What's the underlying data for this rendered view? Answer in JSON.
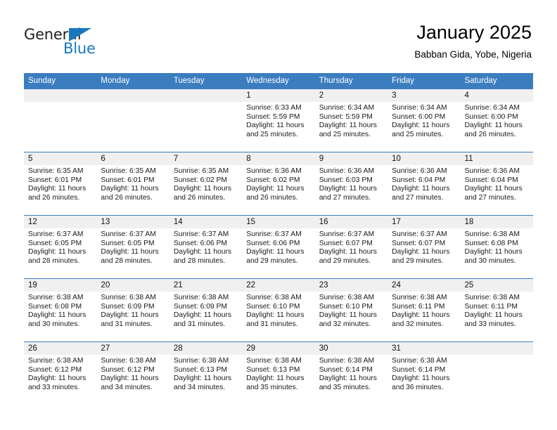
{
  "brand": {
    "name_top": "General",
    "name_bottom": "Blue",
    "accent_color": "#1878be",
    "dark_color": "#231f20"
  },
  "header": {
    "title": "January 2025",
    "subtitle": "Babban Gida, Yobe, Nigeria"
  },
  "calendar": {
    "header_bg": "#3b7dbf",
    "daynum_bg": "#f0f0f0",
    "weekdays": [
      "Sunday",
      "Monday",
      "Tuesday",
      "Wednesday",
      "Thursday",
      "Friday",
      "Saturday"
    ],
    "weeks": [
      [
        {
          "day": "",
          "lines": []
        },
        {
          "day": "",
          "lines": []
        },
        {
          "day": "",
          "lines": []
        },
        {
          "day": "1",
          "lines": [
            "Sunrise: 6:33 AM",
            "Sunset: 5:59 PM",
            "Daylight: 11 hours and 25 minutes."
          ]
        },
        {
          "day": "2",
          "lines": [
            "Sunrise: 6:34 AM",
            "Sunset: 5:59 PM",
            "Daylight: 11 hours and 25 minutes."
          ]
        },
        {
          "day": "3",
          "lines": [
            "Sunrise: 6:34 AM",
            "Sunset: 6:00 PM",
            "Daylight: 11 hours and 25 minutes."
          ]
        },
        {
          "day": "4",
          "lines": [
            "Sunrise: 6:34 AM",
            "Sunset: 6:00 PM",
            "Daylight: 11 hours and 26 minutes."
          ]
        }
      ],
      [
        {
          "day": "5",
          "lines": [
            "Sunrise: 6:35 AM",
            "Sunset: 6:01 PM",
            "Daylight: 11 hours and 26 minutes."
          ]
        },
        {
          "day": "6",
          "lines": [
            "Sunrise: 6:35 AM",
            "Sunset: 6:01 PM",
            "Daylight: 11 hours and 26 minutes."
          ]
        },
        {
          "day": "7",
          "lines": [
            "Sunrise: 6:35 AM",
            "Sunset: 6:02 PM",
            "Daylight: 11 hours and 26 minutes."
          ]
        },
        {
          "day": "8",
          "lines": [
            "Sunrise: 6:36 AM",
            "Sunset: 6:02 PM",
            "Daylight: 11 hours and 26 minutes."
          ]
        },
        {
          "day": "9",
          "lines": [
            "Sunrise: 6:36 AM",
            "Sunset: 6:03 PM",
            "Daylight: 11 hours and 27 minutes."
          ]
        },
        {
          "day": "10",
          "lines": [
            "Sunrise: 6:36 AM",
            "Sunset: 6:04 PM",
            "Daylight: 11 hours and 27 minutes."
          ]
        },
        {
          "day": "11",
          "lines": [
            "Sunrise: 6:36 AM",
            "Sunset: 6:04 PM",
            "Daylight: 11 hours and 27 minutes."
          ]
        }
      ],
      [
        {
          "day": "12",
          "lines": [
            "Sunrise: 6:37 AM",
            "Sunset: 6:05 PM",
            "Daylight: 11 hours and 28 minutes."
          ]
        },
        {
          "day": "13",
          "lines": [
            "Sunrise: 6:37 AM",
            "Sunset: 6:05 PM",
            "Daylight: 11 hours and 28 minutes."
          ]
        },
        {
          "day": "14",
          "lines": [
            "Sunrise: 6:37 AM",
            "Sunset: 6:06 PM",
            "Daylight: 11 hours and 28 minutes."
          ]
        },
        {
          "day": "15",
          "lines": [
            "Sunrise: 6:37 AM",
            "Sunset: 6:06 PM",
            "Daylight: 11 hours and 29 minutes."
          ]
        },
        {
          "day": "16",
          "lines": [
            "Sunrise: 6:37 AM",
            "Sunset: 6:07 PM",
            "Daylight: 11 hours and 29 minutes."
          ]
        },
        {
          "day": "17",
          "lines": [
            "Sunrise: 6:37 AM",
            "Sunset: 6:07 PM",
            "Daylight: 11 hours and 29 minutes."
          ]
        },
        {
          "day": "18",
          "lines": [
            "Sunrise: 6:38 AM",
            "Sunset: 6:08 PM",
            "Daylight: 11 hours and 30 minutes."
          ]
        }
      ],
      [
        {
          "day": "19",
          "lines": [
            "Sunrise: 6:38 AM",
            "Sunset: 6:08 PM",
            "Daylight: 11 hours and 30 minutes."
          ]
        },
        {
          "day": "20",
          "lines": [
            "Sunrise: 6:38 AM",
            "Sunset: 6:09 PM",
            "Daylight: 11 hours and 31 minutes."
          ]
        },
        {
          "day": "21",
          "lines": [
            "Sunrise: 6:38 AM",
            "Sunset: 6:09 PM",
            "Daylight: 11 hours and 31 minutes."
          ]
        },
        {
          "day": "22",
          "lines": [
            "Sunrise: 6:38 AM",
            "Sunset: 6:10 PM",
            "Daylight: 11 hours and 31 minutes."
          ]
        },
        {
          "day": "23",
          "lines": [
            "Sunrise: 6:38 AM",
            "Sunset: 6:10 PM",
            "Daylight: 11 hours and 32 minutes."
          ]
        },
        {
          "day": "24",
          "lines": [
            "Sunrise: 6:38 AM",
            "Sunset: 6:11 PM",
            "Daylight: 11 hours and 32 minutes."
          ]
        },
        {
          "day": "25",
          "lines": [
            "Sunrise: 6:38 AM",
            "Sunset: 6:11 PM",
            "Daylight: 11 hours and 33 minutes."
          ]
        }
      ],
      [
        {
          "day": "26",
          "lines": [
            "Sunrise: 6:38 AM",
            "Sunset: 6:12 PM",
            "Daylight: 11 hours and 33 minutes."
          ]
        },
        {
          "day": "27",
          "lines": [
            "Sunrise: 6:38 AM",
            "Sunset: 6:12 PM",
            "Daylight: 11 hours and 34 minutes."
          ]
        },
        {
          "day": "28",
          "lines": [
            "Sunrise: 6:38 AM",
            "Sunset: 6:13 PM",
            "Daylight: 11 hours and 34 minutes."
          ]
        },
        {
          "day": "29",
          "lines": [
            "Sunrise: 6:38 AM",
            "Sunset: 6:13 PM",
            "Daylight: 11 hours and 35 minutes."
          ]
        },
        {
          "day": "30",
          "lines": [
            "Sunrise: 6:38 AM",
            "Sunset: 6:14 PM",
            "Daylight: 11 hours and 35 minutes."
          ]
        },
        {
          "day": "31",
          "lines": [
            "Sunrise: 6:38 AM",
            "Sunset: 6:14 PM",
            "Daylight: 11 hours and 36 minutes."
          ]
        },
        {
          "day": "",
          "lines": []
        }
      ]
    ]
  }
}
